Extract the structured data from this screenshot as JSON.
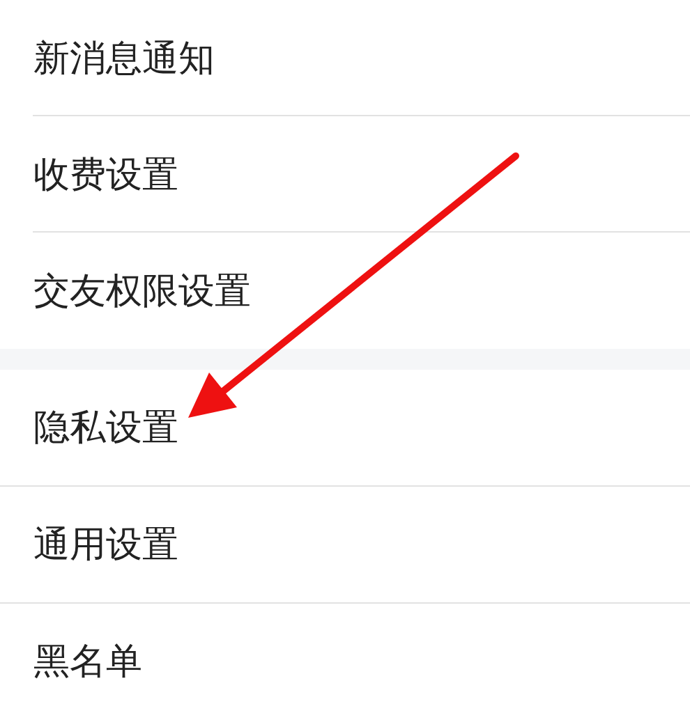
{
  "groups": [
    {
      "items": [
        {
          "label": "新消息通知"
        },
        {
          "label": "收费设置"
        },
        {
          "label": "交友权限设置"
        }
      ]
    },
    {
      "items": [
        {
          "label": "隐私设置"
        },
        {
          "label": "通用设置"
        },
        {
          "label": "黑名单"
        }
      ]
    }
  ]
}
